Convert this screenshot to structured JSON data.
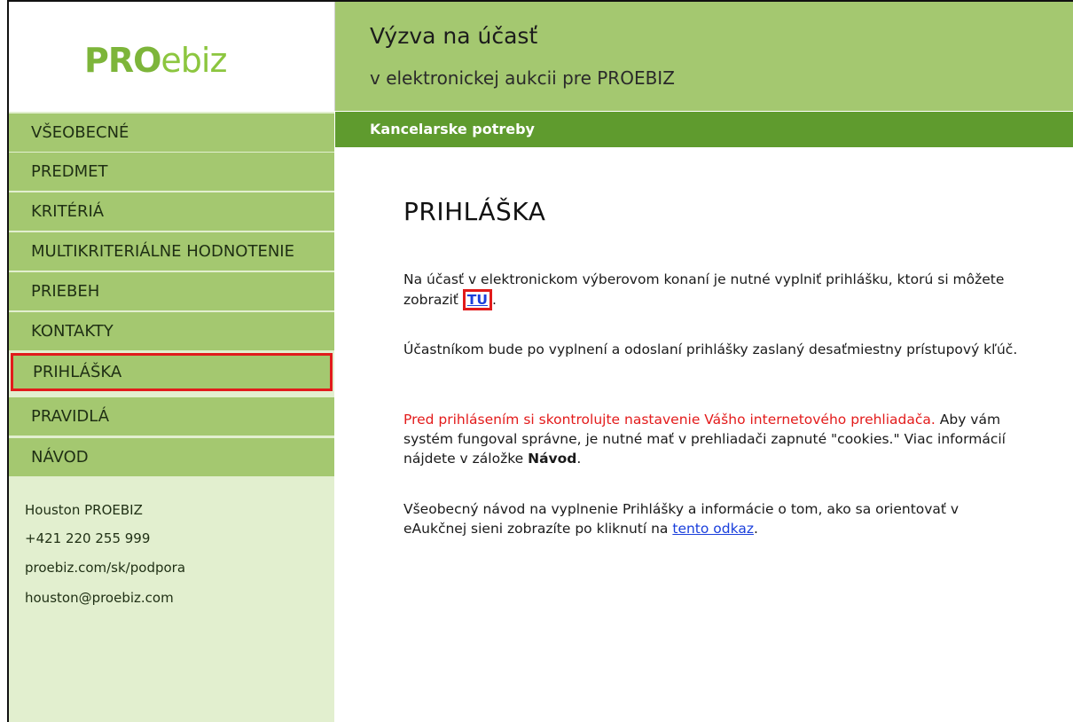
{
  "logo": {
    "part1": "PRO",
    "part2": "ebiz"
  },
  "header": {
    "title": "Výzva na účasť",
    "subtitle": "v elektronickej aukcii pre PROEBIZ"
  },
  "subbar": {
    "label": "Kancelarske potreby"
  },
  "sidebar": {
    "items": [
      {
        "label": "VŠEOBECNÉ"
      },
      {
        "label": "PREDMET"
      },
      {
        "label": "KRITÉRIÁ"
      },
      {
        "label": "MULTIKRITERIÁLNE HODNOTENIE"
      },
      {
        "label": "PRIEBEH"
      },
      {
        "label": "KONTAKTY"
      },
      {
        "label": "PRIHLÁŠKA",
        "active": true
      },
      {
        "label": "PRAVIDLÁ"
      },
      {
        "label": "NÁVOD"
      }
    ],
    "contact": {
      "name": "Houston PROEBIZ",
      "phone": "+421 220 255 999",
      "web": "proebiz.com/sk/podpora",
      "email": "houston@proebiz.com"
    }
  },
  "main": {
    "title": "PRIHLÁŠKA",
    "p1_text": "Na účasť v elektronickom výberovom konaní je nutné vyplniť prihlášku, ktorú si môžete zobraziť ",
    "p1_link": "TU",
    "p1_end": ".",
    "p2_text": "Účastníkom bude po vyplnení a odoslaní prihlášky zaslaný desaťmiestny prístupový kľúč.",
    "p3_red": "Pred prihlásením si skontrolujte nastavenie Vášho internetového prehliadača.",
    "p3_text": " Aby vám systém fungoval správne, je nutné mať v prehliadači zapnuté \"cookies.\" Viac informácií nájdete v záložke ",
    "p3_bold": "Návod",
    "p3_end": ".",
    "p4_text": "Všeobecný návod na vyplnenie Prihlášky a informácie o tom, ako sa orientovať v eAukčnej sieni zobrazíte po kliknutí na ",
    "p4_link": "tento odkaz",
    "p4_end": "."
  },
  "colors": {
    "header_green": "#a4c870",
    "dark_green": "#5f9b2e",
    "sidebar_light": "#e2efcf",
    "highlight_red": "#e11b1b",
    "warning_red": "#e31b1b",
    "link_blue": "#1a3fdc"
  }
}
